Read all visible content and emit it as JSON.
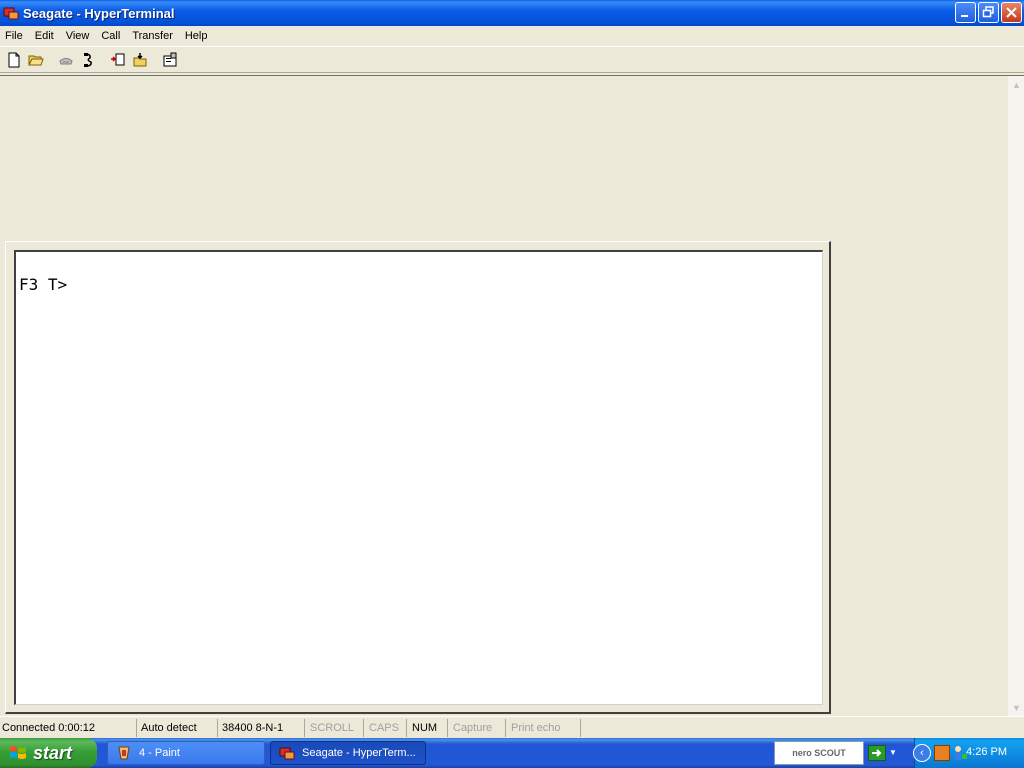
{
  "window": {
    "title": "Seagate - HyperTerminal",
    "icon": "hyperterminal-icon"
  },
  "menu": [
    "File",
    "Edit",
    "View",
    "Call",
    "Transfer",
    "Help"
  ],
  "toolbar": {
    "icons": [
      "new-document-icon",
      "open-folder-icon",
      "connect-phone-icon",
      "disconnect-icon",
      "send-icon",
      "receive-icon",
      "properties-icon"
    ]
  },
  "terminal": {
    "text": "F3 T>"
  },
  "statusbar": {
    "connected": "Connected 0:00:12",
    "detect": "Auto detect",
    "settings": "38400 8-N-1",
    "scroll": "SCROLL",
    "caps": "CAPS",
    "num": "NUM",
    "capture": "Capture",
    "print_echo": "Print echo"
  },
  "taskbar": {
    "start_label": "start",
    "tasks": [
      {
        "label": "4 - Paint",
        "active": false
      },
      {
        "label": "Seagate - HyperTerm...",
        "active": true
      }
    ],
    "nero_label": "nero SCOUT",
    "clock": "4:26 PM"
  },
  "colors": {
    "title_bar": "#0a5fe8",
    "window_bg": "#ece9d8",
    "terminal_bg": "#ffffff",
    "taskbar": "#2257d5",
    "start_button": "#37a037"
  }
}
